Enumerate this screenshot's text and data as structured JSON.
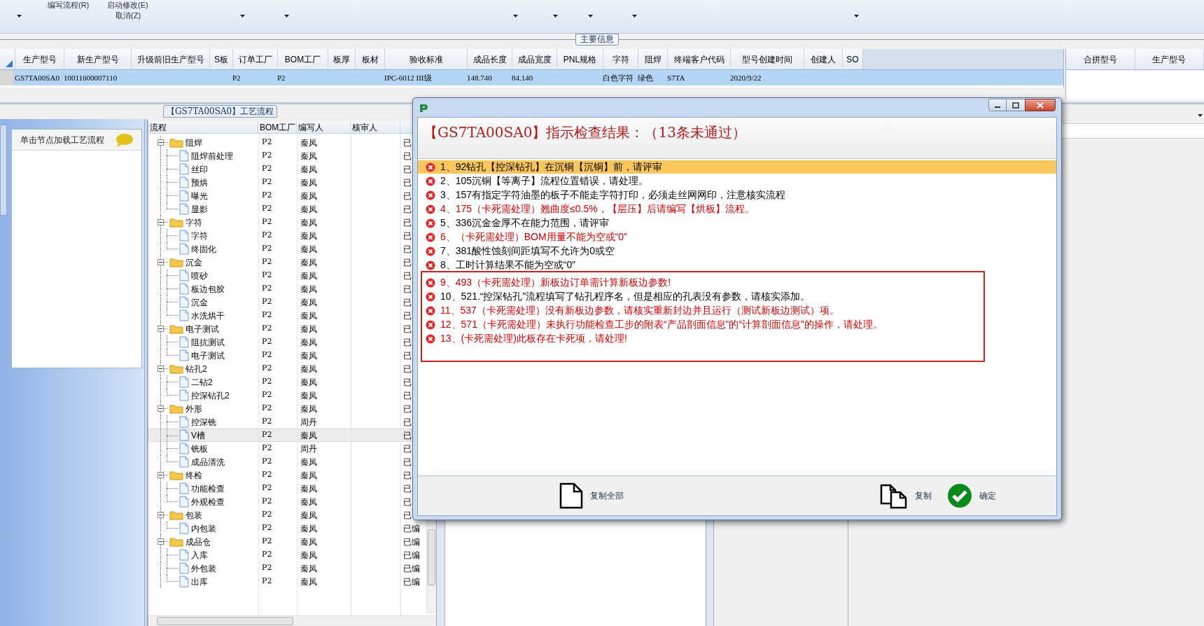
{
  "ribbon": {
    "menu_items": [
      "编写流程(R)",
      "启动修改(E)",
      "取消(Z)"
    ]
  },
  "main_info": {
    "group_label": "主要信息",
    "columns": [
      "生产型号",
      "新生产型号",
      "升级前旧生产型号",
      "S板",
      "订单工厂",
      "BOM工厂",
      "板厚",
      "板材",
      "验收标准",
      "成品长度",
      "成品宽度",
      "PNL规格",
      "字符",
      "阻焊",
      "终端客户代码",
      "型号创建时间",
      "创建人",
      "SO"
    ],
    "rows": [
      {
        "selected": true,
        "cells": [
          "GS7TA00SA0",
          "10011600007110",
          "",
          "",
          "P2",
          "P2",
          "",
          "",
          "IPC-6012 III级",
          "148.740",
          "84.140",
          "",
          "白色字符",
          "绿色",
          "S7TA",
          "2020/9/22",
          "",
          ""
        ]
      }
    ]
  },
  "merge_panel": {
    "columns": [
      "合拼型号",
      "生产型号"
    ]
  },
  "process_tab": {
    "label": "【GS7TA00SA0】工艺流程"
  },
  "left_panel": {
    "header": "单击节点加载工艺流程"
  },
  "process_tree": {
    "columns": [
      "流程",
      "BOM工厂",
      "编写人",
      "核审人"
    ],
    "nodes": [
      {
        "label": "阻焊",
        "bom": "P2",
        "author": "秦凤",
        "status": "已",
        "expanded": true,
        "selected": false,
        "children": [
          {
            "label": "阻焊前处理",
            "bom": "P2",
            "author": "秦凤",
            "status": "已",
            "selected": false
          },
          {
            "label": "丝印",
            "bom": "P2",
            "author": "秦凤",
            "status": "已",
            "selected": false
          },
          {
            "label": "预烘",
            "bom": "P2",
            "author": "秦凤",
            "status": "已",
            "selected": false
          },
          {
            "label": "曝光",
            "bom": "P2",
            "author": "秦凤",
            "status": "已",
            "selected": false
          },
          {
            "label": "显影",
            "bom": "P2",
            "author": "秦凤",
            "status": "已",
            "selected": false
          }
        ]
      },
      {
        "label": "字符",
        "bom": "P2",
        "author": "秦凤",
        "status": "已",
        "expanded": true,
        "selected": false,
        "children": [
          {
            "label": "字符",
            "bom": "P2",
            "author": "秦凤",
            "status": "已",
            "selected": false
          },
          {
            "label": "终固化",
            "bom": "P2",
            "author": "秦凤",
            "status": "已",
            "selected": false
          }
        ]
      },
      {
        "label": "沉金",
        "bom": "P2",
        "author": "秦凤",
        "status": "已",
        "expanded": true,
        "selected": false,
        "children": [
          {
            "label": "喷砂",
            "bom": "P2",
            "author": "秦凤",
            "status": "已",
            "selected": false
          },
          {
            "label": "板边包胶",
            "bom": "P2",
            "author": "秦凤",
            "status": "已",
            "selected": false
          },
          {
            "label": "沉金",
            "bom": "P2",
            "author": "秦凤",
            "status": "已",
            "selected": false
          },
          {
            "label": "水洗烘干",
            "bom": "P2",
            "author": "秦凤",
            "status": "已",
            "selected": false
          }
        ]
      },
      {
        "label": "电子测试",
        "bom": "P2",
        "author": "秦凤",
        "status": "已",
        "expanded": true,
        "selected": false,
        "children": [
          {
            "label": "阻抗测试",
            "bom": "P2",
            "author": "秦凤",
            "status": "已",
            "selected": false
          },
          {
            "label": "电子测试",
            "bom": "P2",
            "author": "秦凤",
            "status": "已",
            "selected": false
          }
        ]
      },
      {
        "label": "钻孔2",
        "bom": "P2",
        "author": "秦凤",
        "status": "已",
        "expanded": true,
        "selected": false,
        "children": [
          {
            "label": "二钻2",
            "bom": "P2",
            "author": "秦凤",
            "status": "已",
            "selected": false
          },
          {
            "label": "控深钻孔2",
            "bom": "P2",
            "author": "秦凤",
            "status": "已",
            "selected": false
          }
        ]
      },
      {
        "label": "外形",
        "bom": "P2",
        "author": "秦凤",
        "status": "已",
        "expanded": true,
        "selected": false,
        "children": [
          {
            "label": "控深铣",
            "bom": "P2",
            "author": "周丹",
            "status": "已",
            "selected": false
          },
          {
            "label": "V槽",
            "bom": "P2",
            "author": "秦凤",
            "status": "已",
            "selected": true
          },
          {
            "label": "铣板",
            "bom": "P2",
            "author": "周丹",
            "status": "已",
            "selected": false
          },
          {
            "label": "成品清洗",
            "bom": "P2",
            "author": "秦凤",
            "status": "已",
            "selected": false
          }
        ]
      },
      {
        "label": "终检",
        "bom": "P2",
        "author": "秦凤",
        "status": "已",
        "expanded": true,
        "selected": false,
        "children": [
          {
            "label": "功能检查",
            "bom": "P2",
            "author": "秦凤",
            "status": "已",
            "selected": false
          },
          {
            "label": "外观检查",
            "bom": "P2",
            "author": "秦凤",
            "status": "已",
            "selected": false
          }
        ]
      },
      {
        "label": "包装",
        "bom": "P2",
        "author": "秦凤",
        "status": "已",
        "expanded": true,
        "selected": false,
        "children": [
          {
            "label": "内包装",
            "bom": "P2",
            "author": "秦凤",
            "status": "已编",
            "selected": false
          }
        ]
      },
      {
        "label": "成品仓",
        "bom": "P2",
        "author": "秦凤",
        "status": "已编",
        "expanded": true,
        "selected": false,
        "children": [
          {
            "label": "入库",
            "bom": "P2",
            "author": "秦凤",
            "status": "已编",
            "selected": false
          },
          {
            "label": "外包装",
            "bom": "P2",
            "author": "秦凤",
            "status": "已编",
            "selected": false
          },
          {
            "label": "出库",
            "bom": "P2",
            "author": "秦凤",
            "status": "已编",
            "selected": false
          }
        ]
      }
    ]
  },
  "dialog": {
    "heading": "【GS7TA00SA0】指示检查结果：（13条未通过）",
    "results": [
      {
        "text": "1、92钻孔【控深钻孔】在沉铜【沉铜】前，请评审",
        "kind": "normal",
        "selected": true
      },
      {
        "text": "2、105沉铜【等离子】流程位置错误，请处理。",
        "kind": "normal",
        "selected": false
      },
      {
        "text": "3、157有指定字符油墨的板子不能走字符打印，必须走丝网网印，注意核实流程",
        "kind": "normal",
        "selected": false
      },
      {
        "text": "4、175（卡死需处理）翘曲度≤0.5%，【层压】后请编写【烘板】流程。",
        "kind": "blocking",
        "selected": false
      },
      {
        "text": "5、336沉金金厚不在能力范围，请评审",
        "kind": "normal",
        "selected": false
      },
      {
        "text": "6、（卡死需处理）BOM用量不能为空或“0”",
        "kind": "blocking",
        "selected": false
      },
      {
        "text": "7、381酸性蚀刻间距填写不允许为0或空",
        "kind": "normal",
        "selected": false
      },
      {
        "text": "8、工时计算结果不能为空或“0”",
        "kind": "normal",
        "selected": false
      },
      {
        "text": "9、493（卡死需处理）新板边订单需计算新板边参数!",
        "kind": "blocking",
        "selected": false
      },
      {
        "text": "10、521.“控深钻孔”流程填写了钻孔程序名，但是相应的孔表没有参数，请核实添加。",
        "kind": "normal",
        "selected": false
      },
      {
        "text": "11、537（卡死需处理）没有新板边参数，请核实重新封边并且运行（测试新板边测试）项。",
        "kind": "blocking",
        "selected": false
      },
      {
        "text": "12、571（卡死需处理）未执行功能检查工步的附表“产品剖面信息”的“计算剖面信息”的操作，请处理。",
        "kind": "blocking",
        "selected": false
      },
      {
        "text": "13、(卡死需处理)此板存在卡死项，请处理!",
        "kind": "blocking",
        "selected": false
      }
    ],
    "buttons": [
      {
        "kind": "copy_all",
        "label": "复制全部"
      },
      {
        "kind": "copy",
        "label": "复制"
      },
      {
        "kind": "ok",
        "label": "确定"
      }
    ]
  }
}
